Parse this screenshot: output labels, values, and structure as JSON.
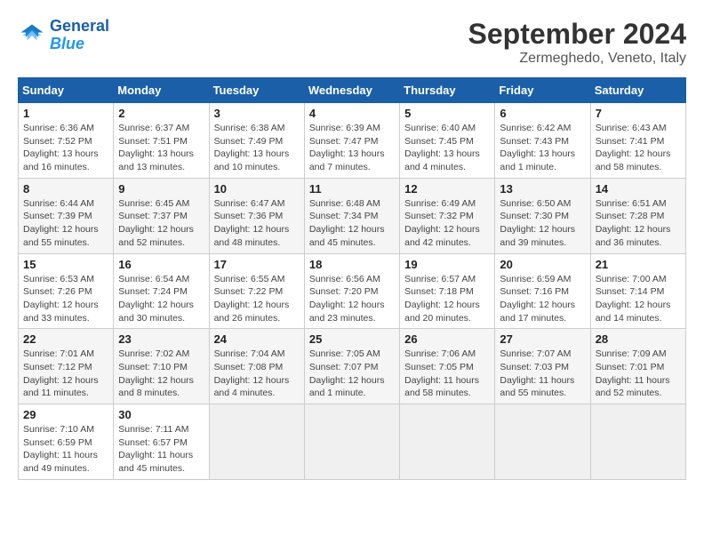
{
  "header": {
    "logo_line1": "General",
    "logo_line2": "Blue",
    "month": "September 2024",
    "location": "Zermeghedo, Veneto, Italy"
  },
  "weekdays": [
    "Sunday",
    "Monday",
    "Tuesday",
    "Wednesday",
    "Thursday",
    "Friday",
    "Saturday"
  ],
  "weeks": [
    [
      {
        "day": "1",
        "info": "Sunrise: 6:36 AM\nSunset: 7:52 PM\nDaylight: 13 hours\nand 16 minutes."
      },
      {
        "day": "2",
        "info": "Sunrise: 6:37 AM\nSunset: 7:51 PM\nDaylight: 13 hours\nand 13 minutes."
      },
      {
        "day": "3",
        "info": "Sunrise: 6:38 AM\nSunset: 7:49 PM\nDaylight: 13 hours\nand 10 minutes."
      },
      {
        "day": "4",
        "info": "Sunrise: 6:39 AM\nSunset: 7:47 PM\nDaylight: 13 hours\nand 7 minutes."
      },
      {
        "day": "5",
        "info": "Sunrise: 6:40 AM\nSunset: 7:45 PM\nDaylight: 13 hours\nand 4 minutes."
      },
      {
        "day": "6",
        "info": "Sunrise: 6:42 AM\nSunset: 7:43 PM\nDaylight: 13 hours\nand 1 minute."
      },
      {
        "day": "7",
        "info": "Sunrise: 6:43 AM\nSunset: 7:41 PM\nDaylight: 12 hours\nand 58 minutes."
      }
    ],
    [
      {
        "day": "8",
        "info": "Sunrise: 6:44 AM\nSunset: 7:39 PM\nDaylight: 12 hours\nand 55 minutes."
      },
      {
        "day": "9",
        "info": "Sunrise: 6:45 AM\nSunset: 7:37 PM\nDaylight: 12 hours\nand 52 minutes."
      },
      {
        "day": "10",
        "info": "Sunrise: 6:47 AM\nSunset: 7:36 PM\nDaylight: 12 hours\nand 48 minutes."
      },
      {
        "day": "11",
        "info": "Sunrise: 6:48 AM\nSunset: 7:34 PM\nDaylight: 12 hours\nand 45 minutes."
      },
      {
        "day": "12",
        "info": "Sunrise: 6:49 AM\nSunset: 7:32 PM\nDaylight: 12 hours\nand 42 minutes."
      },
      {
        "day": "13",
        "info": "Sunrise: 6:50 AM\nSunset: 7:30 PM\nDaylight: 12 hours\nand 39 minutes."
      },
      {
        "day": "14",
        "info": "Sunrise: 6:51 AM\nSunset: 7:28 PM\nDaylight: 12 hours\nand 36 minutes."
      }
    ],
    [
      {
        "day": "15",
        "info": "Sunrise: 6:53 AM\nSunset: 7:26 PM\nDaylight: 12 hours\nand 33 minutes."
      },
      {
        "day": "16",
        "info": "Sunrise: 6:54 AM\nSunset: 7:24 PM\nDaylight: 12 hours\nand 30 minutes."
      },
      {
        "day": "17",
        "info": "Sunrise: 6:55 AM\nSunset: 7:22 PM\nDaylight: 12 hours\nand 26 minutes."
      },
      {
        "day": "18",
        "info": "Sunrise: 6:56 AM\nSunset: 7:20 PM\nDaylight: 12 hours\nand 23 minutes."
      },
      {
        "day": "19",
        "info": "Sunrise: 6:57 AM\nSunset: 7:18 PM\nDaylight: 12 hours\nand 20 minutes."
      },
      {
        "day": "20",
        "info": "Sunrise: 6:59 AM\nSunset: 7:16 PM\nDaylight: 12 hours\nand 17 minutes."
      },
      {
        "day": "21",
        "info": "Sunrise: 7:00 AM\nSunset: 7:14 PM\nDaylight: 12 hours\nand 14 minutes."
      }
    ],
    [
      {
        "day": "22",
        "info": "Sunrise: 7:01 AM\nSunset: 7:12 PM\nDaylight: 12 hours\nand 11 minutes."
      },
      {
        "day": "23",
        "info": "Sunrise: 7:02 AM\nSunset: 7:10 PM\nDaylight: 12 hours\nand 8 minutes."
      },
      {
        "day": "24",
        "info": "Sunrise: 7:04 AM\nSunset: 7:08 PM\nDaylight: 12 hours\nand 4 minutes."
      },
      {
        "day": "25",
        "info": "Sunrise: 7:05 AM\nSunset: 7:07 PM\nDaylight: 12 hours\nand 1 minute."
      },
      {
        "day": "26",
        "info": "Sunrise: 7:06 AM\nSunset: 7:05 PM\nDaylight: 11 hours\nand 58 minutes."
      },
      {
        "day": "27",
        "info": "Sunrise: 7:07 AM\nSunset: 7:03 PM\nDaylight: 11 hours\nand 55 minutes."
      },
      {
        "day": "28",
        "info": "Sunrise: 7:09 AM\nSunset: 7:01 PM\nDaylight: 11 hours\nand 52 minutes."
      }
    ],
    [
      {
        "day": "29",
        "info": "Sunrise: 7:10 AM\nSunset: 6:59 PM\nDaylight: 11 hours\nand 49 minutes."
      },
      {
        "day": "30",
        "info": "Sunrise: 7:11 AM\nSunset: 6:57 PM\nDaylight: 11 hours\nand 45 minutes."
      },
      {
        "day": "",
        "info": ""
      },
      {
        "day": "",
        "info": ""
      },
      {
        "day": "",
        "info": ""
      },
      {
        "day": "",
        "info": ""
      },
      {
        "day": "",
        "info": ""
      }
    ]
  ]
}
